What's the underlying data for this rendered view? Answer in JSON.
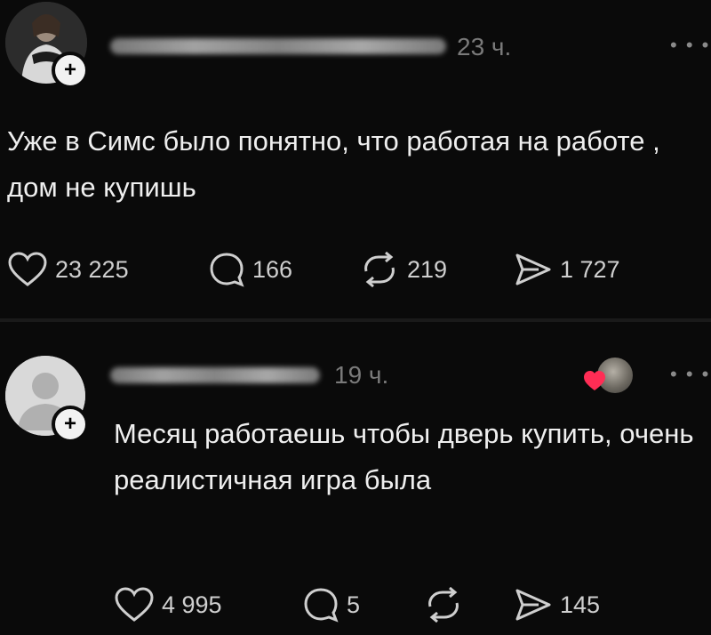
{
  "posts": [
    {
      "time": "23 ч.",
      "text": "Уже в Симс было понятно, что работая на работе , дом не купишь",
      "likes": "23 225",
      "comments": "166",
      "reposts": "219",
      "shares": "1 727"
    },
    {
      "time": "19 ч.",
      "text": "Месяц работаешь чтобы дверь купить, очень реалистичная игра была",
      "likes": "4 995",
      "comments": "5",
      "reposts": "",
      "shares": "145"
    }
  ],
  "more_glyph": "• • •",
  "follow_glyph": "+",
  "colors": {
    "background": "#0a0a0a",
    "text": "#efefef",
    "muted": "#7a7a7a",
    "heart_badge": "#ff2d55"
  },
  "icons": [
    "heart-icon",
    "comment-icon",
    "repost-icon",
    "share-icon",
    "more-icon",
    "plus-icon"
  ]
}
